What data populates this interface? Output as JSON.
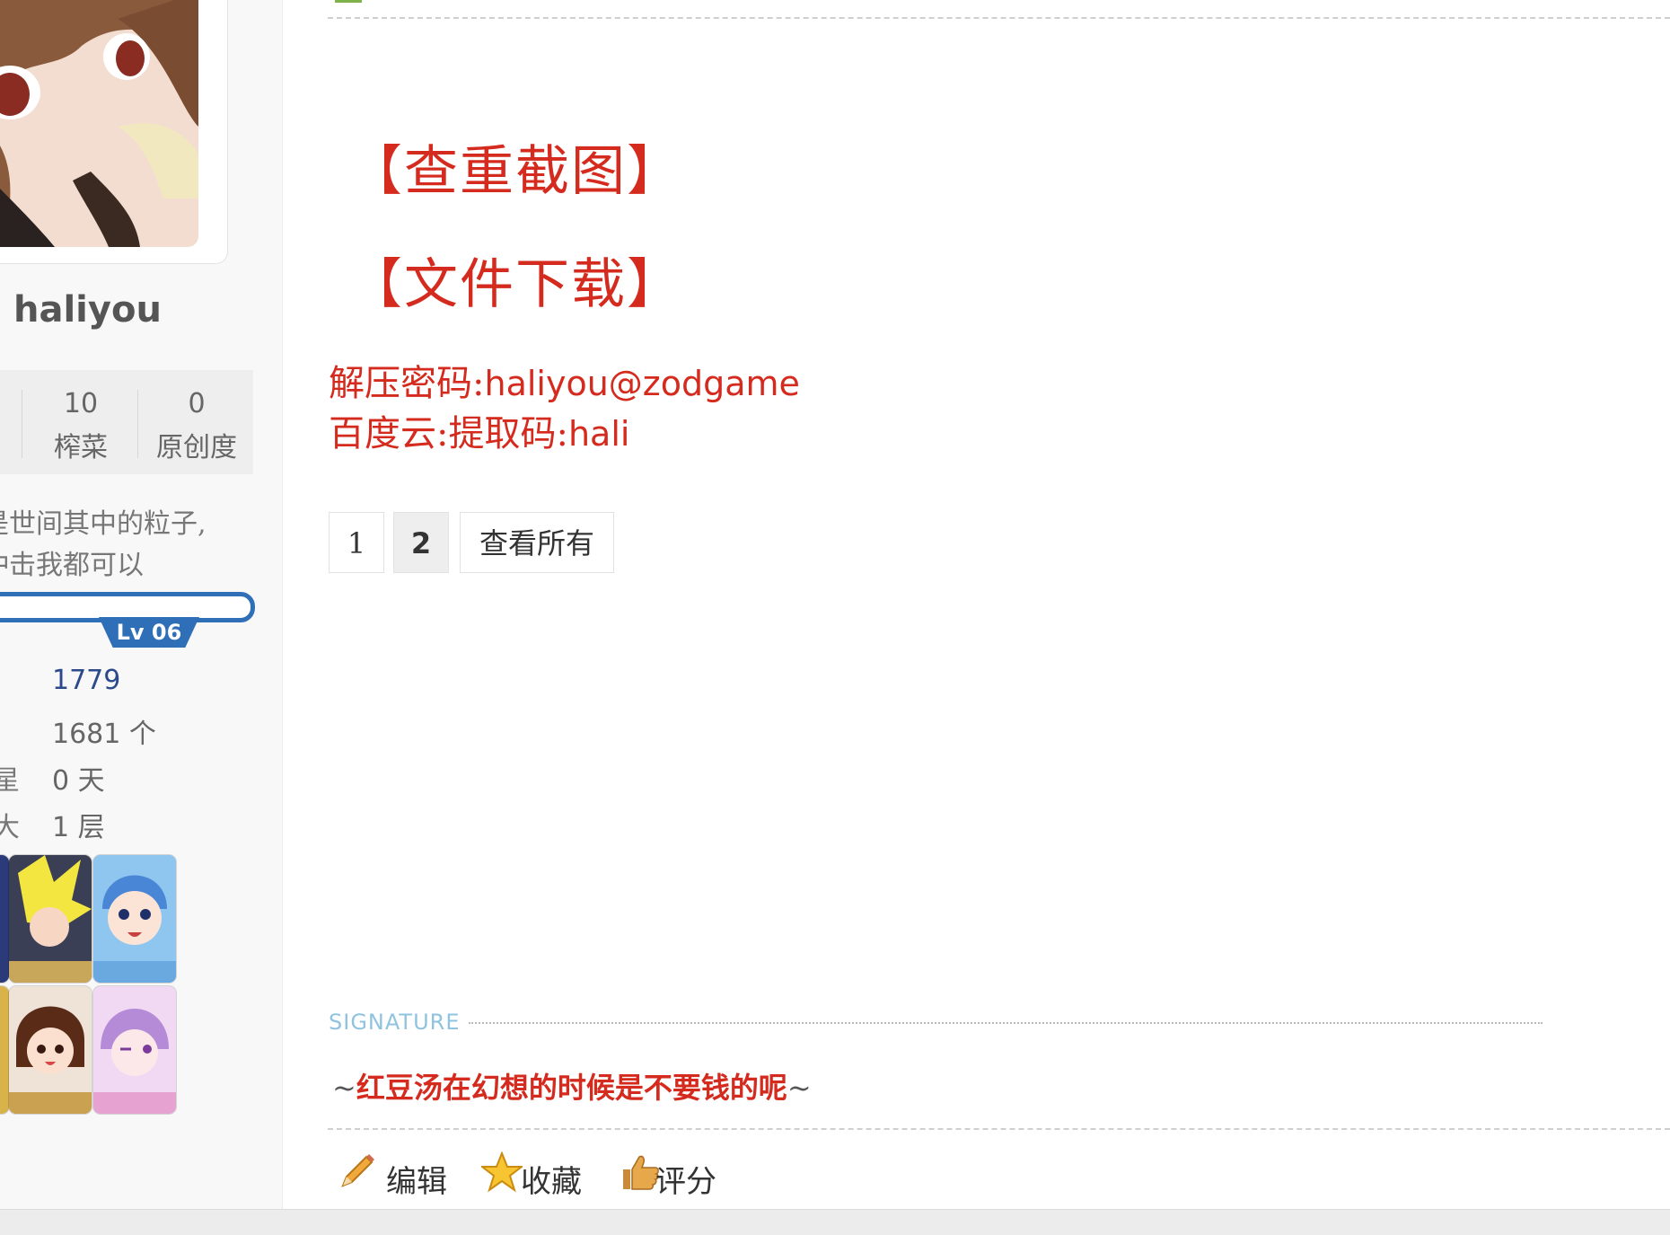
{
  "user": {
    "name": "haliyou",
    "stats": [
      {
        "value": "10",
        "label": "榨菜"
      },
      {
        "value": "0",
        "label": "原创度"
      }
    ],
    "bio_line1": "是世间其中的粒子,",
    "bio_line2": "冲击我都可以",
    "level": "Lv 06",
    "info": [
      {
        "key": "",
        "value": "1779"
      },
      {
        "key": "",
        "value": "1681 个"
      },
      {
        "key": "星",
        "value": "0 天"
      },
      {
        "key": "大",
        "value": "1 层"
      }
    ],
    "medals_count_label": ""
  },
  "post": {
    "headings": [
      "【查重截图】",
      "【文件下载】"
    ],
    "password_label": "解压密码:",
    "password_value": "haliyou@zodgame",
    "baidu_label": "百度云:提取码:",
    "baidu_value": "hali"
  },
  "pager": {
    "pages": [
      "1",
      "2"
    ],
    "current": "2",
    "view_all": "查看所有"
  },
  "signature": {
    "label": "SIGNATURE",
    "tilde_left": "~",
    "text": "红豆汤在幻想的时候是不要钱的呢",
    "tilde_right": "~"
  },
  "actions": [
    {
      "label": "编辑",
      "icon": "pencil-icon"
    },
    {
      "label": "收藏",
      "icon": "star-icon"
    },
    {
      "label": "评分",
      "icon": "thumbs-up-icon"
    }
  ],
  "colors": {
    "accent_red": "#d52a1e",
    "level_blue": "#2f6fb8",
    "link_blue": "#2b4a8b"
  }
}
